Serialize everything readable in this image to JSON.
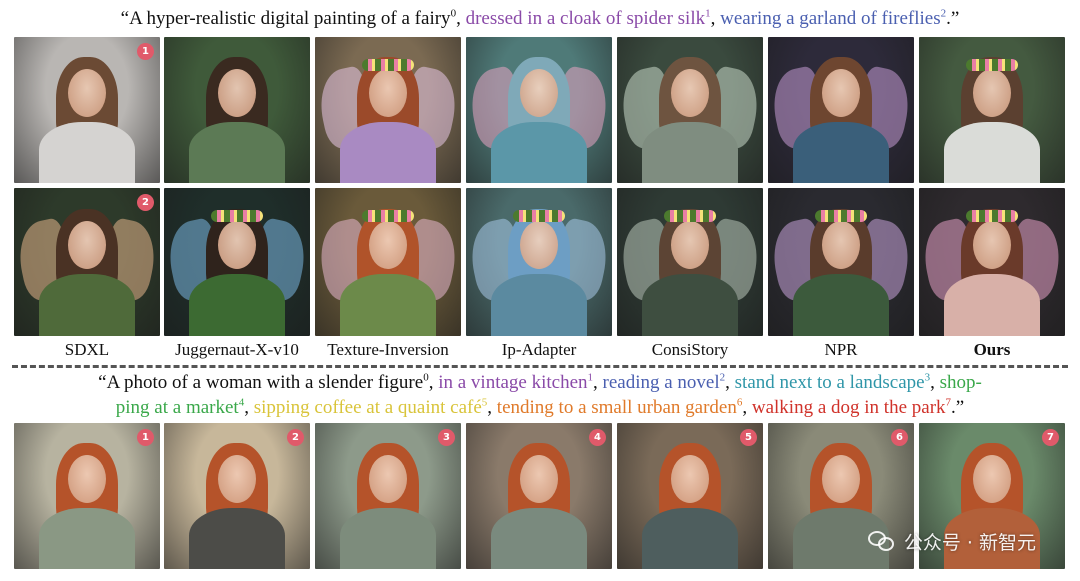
{
  "caption_top": {
    "segments": [
      {
        "text": "“A hyper-realistic digital painting of a fairy",
        "color": "#111111",
        "sup": "0"
      },
      {
        "text": ", ",
        "color": "#111111",
        "sup": ""
      },
      {
        "text": "dressed in a cloak of spider silk",
        "color": "#8a4aa8",
        "sup": "1"
      },
      {
        "text": ", ",
        "color": "#111111",
        "sup": ""
      },
      {
        "text": "wearing a garland of fireflies",
        "color": "#4a5fb0",
        "sup": "2"
      },
      {
        "text": ".”",
        "color": "#111111",
        "sup": ""
      }
    ]
  },
  "caption_bottom": {
    "line1": [
      {
        "text": "“A photo of a woman with a slender figure",
        "color": "#111111",
        "sup": "0"
      },
      {
        "text": ", ",
        "color": "#111111",
        "sup": ""
      },
      {
        "text": "in a vintage kitchen",
        "color": "#8a4aa8",
        "sup": "1"
      },
      {
        "text": ", ",
        "color": "#111111",
        "sup": ""
      },
      {
        "text": "reading a novel",
        "color": "#4a5fb0",
        "sup": "2"
      },
      {
        "text": ", ",
        "color": "#111111",
        "sup": ""
      },
      {
        "text": "stand next to a landscape",
        "color": "#2f96a8",
        "sup": "3"
      },
      {
        "text": ", ",
        "color": "#111111",
        "sup": ""
      },
      {
        "text": "shop-",
        "color": "#3aa84a",
        "sup": ""
      }
    ],
    "line2": [
      {
        "text": "ping at a market",
        "color": "#3aa84a",
        "sup": "4"
      },
      {
        "text": ", ",
        "color": "#111111",
        "sup": ""
      },
      {
        "text": "sipping coffee at a quaint café",
        "color": "#d9c43a",
        "sup": "5"
      },
      {
        "text": ", ",
        "color": "#111111",
        "sup": ""
      },
      {
        "text": "tending to a small urban garden",
        "color": "#e07a2a",
        "sup": "6"
      },
      {
        "text": ", ",
        "color": "#111111",
        "sup": ""
      },
      {
        "text": "walking a dog in the park",
        "color": "#d0322a",
        "sup": "7"
      },
      {
        "text": ".”",
        "color": "#111111",
        "sup": ""
      }
    ]
  },
  "methods": [
    "SDXL",
    "Juggernaut-X-v10",
    "Texture-Inversion",
    "Ip-Adapter",
    "ConsiStory",
    "NPR",
    "Ours"
  ],
  "row1_badge": "1",
  "row2_badge": "2",
  "row3_badges": [
    "1",
    "2",
    "3",
    "4",
    "5",
    "6",
    "7"
  ],
  "watermark": {
    "text": "公众号 · 新智元",
    "icon": "wechat-icon"
  },
  "tiles": {
    "row1": [
      {
        "bg": "#b9b6b3",
        "hair": "#6b4a34",
        "body": "#d5d3d1",
        "wing": "",
        "crown": false
      },
      {
        "bg": "#3f5a3a",
        "hair": "#3a2a20",
        "body": "#5c7a55",
        "wing": "",
        "crown": false
      },
      {
        "bg": "#7b6a52",
        "hair": "#9b4a2a",
        "body": "#a98ac2",
        "wing": "#e7c6e6",
        "crown": true
      },
      {
        "bg": "#4f7a78",
        "hair": "#7fa9b8",
        "body": "#5b97a8",
        "wing": "#e8a4c2",
        "crown": false
      },
      {
        "bg": "#3a4a3e",
        "hair": "#6e5440",
        "body": "#7f8d80",
        "wing": "#c9d8c8",
        "crown": false
      },
      {
        "bg": "#2d2a3a",
        "hair": "#6e4630",
        "body": "#3a5f7a",
        "wing": "#c49ad4",
        "crown": false
      },
      {
        "bg": "#445a40",
        "hair": "#5b4030",
        "body": "#dadcd8",
        "wing": "",
        "crown": true
      }
    ],
    "row2": [
      {
        "bg": "#2d3a2a",
        "hair": "#4a3224",
        "body": "#4f6a3a",
        "wing": "#e3b48a",
        "crown": false
      },
      {
        "bg": "#1f2e2a",
        "hair": "#2f231c",
        "body": "#3c6a32",
        "wing": "#7ab6e0",
        "crown": true
      },
      {
        "bg": "#6a5a3a",
        "hair": "#b0532a",
        "body": "#6c8a4a",
        "wing": "#e7b8d0",
        "crown": true
      },
      {
        "bg": "#4a6a6a",
        "hair": "#6d9ec4",
        "body": "#5b8aa0",
        "wing": "#a8c8e8",
        "crown": true
      },
      {
        "bg": "#2e3a34",
        "hair": "#5c4434",
        "body": "#3e4e40",
        "wing": "#b9c6ba",
        "crown": true
      },
      {
        "bg": "#2a2a30",
        "hair": "#5a3c2c",
        "body": "#3c5a3c",
        "wing": "#c6a2d8",
        "crown": true
      },
      {
        "bg": "#2e2a2e",
        "hair": "#6a3a2a",
        "body": "#d8b0a8",
        "wing": "#e6a0c6",
        "crown": true
      }
    ],
    "row3": [
      {
        "bg": "#b7b3a0",
        "hair": "#b5532a",
        "body": "#8a9884"
      },
      {
        "bg": "#c7b79a",
        "hair": "#b5532a",
        "body": "#4c4c48"
      },
      {
        "bg": "#8d9a8a",
        "hair": "#b5532a",
        "body": "#7d8c7c"
      },
      {
        "bg": "#8a7a6a",
        "hair": "#b5532a",
        "body": "#7a8a7e"
      },
      {
        "bg": "#7a6a58",
        "hair": "#b5532a",
        "body": "#4e5e5e"
      },
      {
        "bg": "#8a8a78",
        "hair": "#b5532a",
        "body": "#6e7a6c"
      },
      {
        "bg": "#6a8a6a",
        "hair": "#b5532a",
        "body": "#b2603a"
      }
    ]
  }
}
